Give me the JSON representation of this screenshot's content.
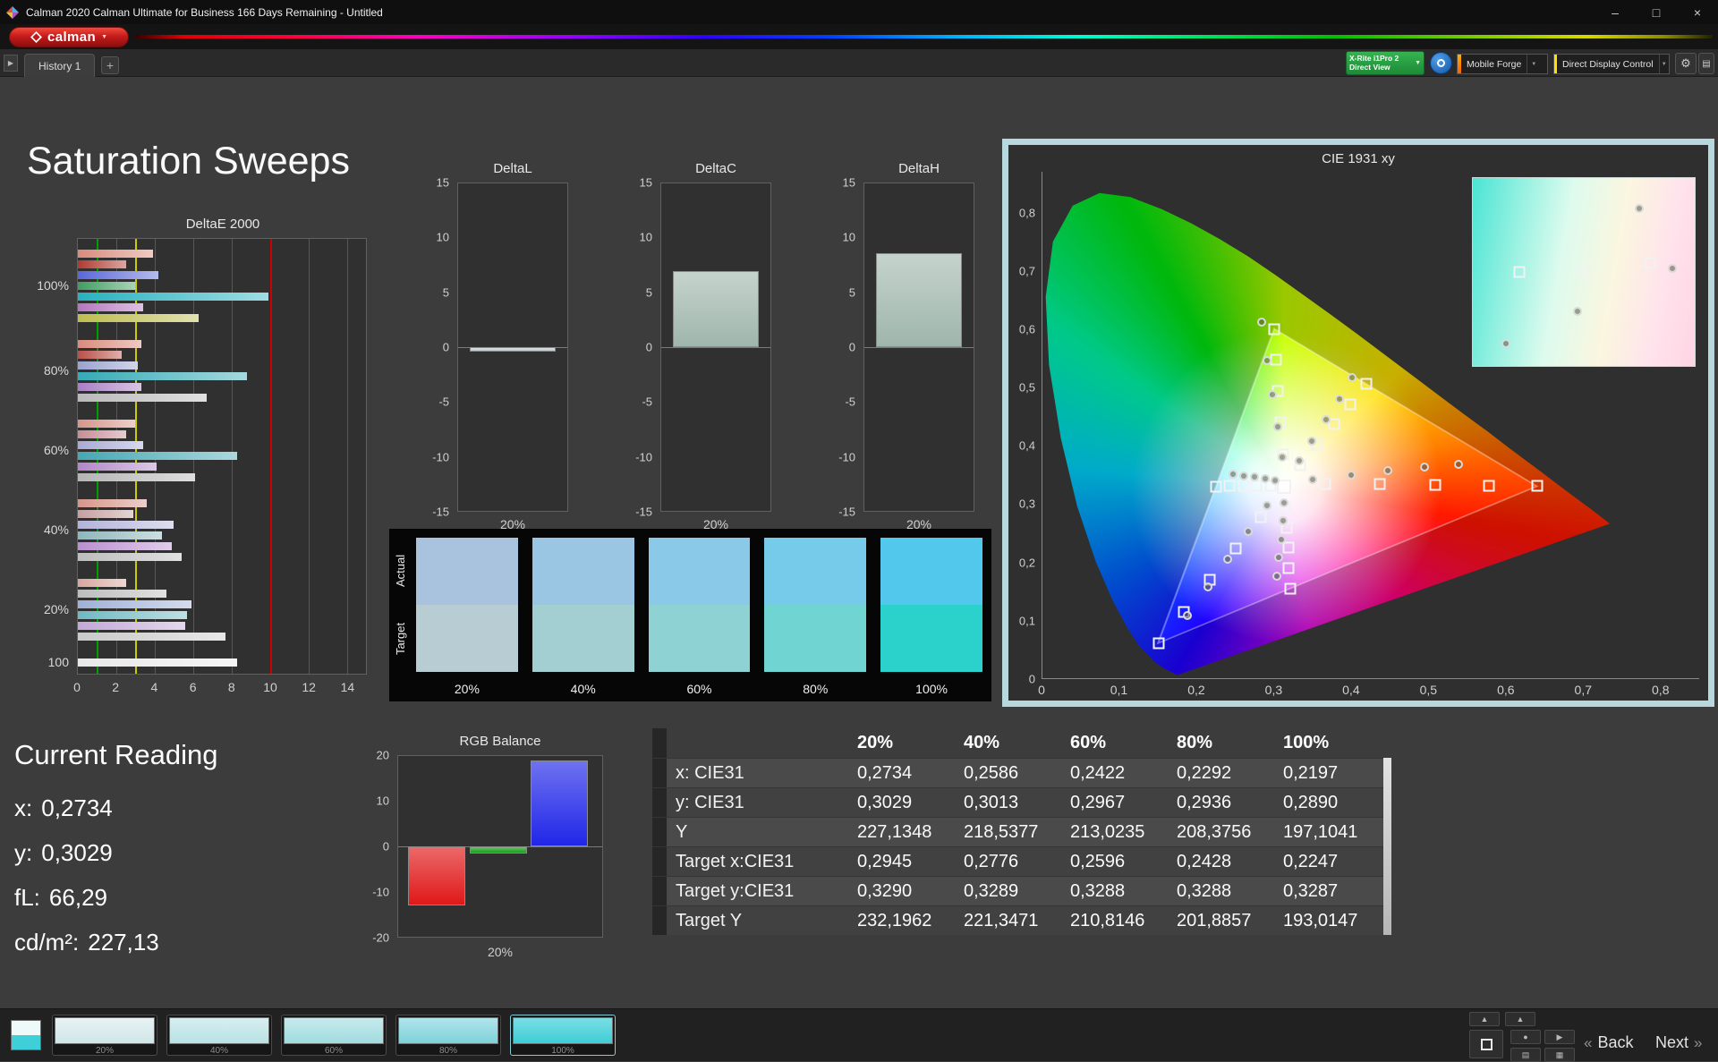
{
  "window": {
    "title": "Calman 2020 Calman Ultimate for Business 166 Days Remaining - Untitled",
    "minimize": "–",
    "maximize": "□",
    "close": "×"
  },
  "toolbar": {
    "logo": "calman",
    "caret": "▼"
  },
  "tab_bar": {
    "panel_toggle": "▶",
    "tab": "History 1",
    "add_tab": "+",
    "meter_button": {
      "line1": "X-Rite i1Pro 2",
      "line2": "Direct View",
      "caret": "▼"
    },
    "source_dropdown": {
      "label": "Mobile Forge",
      "caret": "▼"
    },
    "control_dropdown": {
      "label": "Direct Display Control",
      "caret": "▼"
    },
    "gear": "⚙",
    "layout": "▤"
  },
  "page_title": "Saturation Sweeps",
  "current_reading": {
    "title": "Current Reading",
    "lines": [
      {
        "label": "x:",
        "value": "0,2734"
      },
      {
        "label": "y:",
        "value": "0,3029"
      },
      {
        "label": "fL:",
        "value": "66,29"
      },
      {
        "label": "cd/m²:",
        "value": "227,13"
      }
    ]
  },
  "table": {
    "columns": [
      "20%",
      "40%",
      "60%",
      "80%",
      "100%"
    ],
    "rows": [
      {
        "label": "x: CIE31",
        "values": [
          "0,2734",
          "0,2586",
          "0,2422",
          "0,2292",
          "0,2197"
        ]
      },
      {
        "label": "y: CIE31",
        "values": [
          "0,3029",
          "0,3013",
          "0,2967",
          "0,2936",
          "0,2890"
        ]
      },
      {
        "label": "Y",
        "values": [
          "227,1348",
          "218,5377",
          "213,0235",
          "208,3756",
          "197,1041"
        ]
      },
      {
        "label": "Target x:CIE31",
        "values": [
          "0,2945",
          "0,2776",
          "0,2596",
          "0,2428",
          "0,2247"
        ]
      },
      {
        "label": "Target y:CIE31",
        "values": [
          "0,3290",
          "0,3289",
          "0,3288",
          "0,3288",
          "0,3287"
        ]
      },
      {
        "label": "Target Y",
        "values": [
          "232,1962",
          "221,3471",
          "210,8146",
          "201,8857",
          "193,0147"
        ]
      }
    ]
  },
  "swatches": {
    "row_labels": [
      "Actual",
      "Target"
    ],
    "columns": [
      {
        "label": "20%",
        "actual": "#a9c3df",
        "target": "#b7cdd3"
      },
      {
        "label": "40%",
        "actual": "#9bc6e3",
        "target": "#a3cfd3"
      },
      {
        "label": "60%",
        "actual": "#8ac9e7",
        "target": "#8ed2d3"
      },
      {
        "label": "80%",
        "actual": "#76cbea",
        "target": "#70d4d2"
      },
      {
        "label": "100%",
        "actual": "#52c8ec",
        "target": "#2bd2cb"
      }
    ]
  },
  "chart_data": {
    "deltaE2000": {
      "type": "bar",
      "orientation": "horizontal",
      "title": "DeltaE 2000",
      "xlim": [
        0,
        15
      ],
      "xticks": [
        0,
        2,
        4,
        6,
        8,
        10,
        12,
        14
      ],
      "guides": [
        {
          "value": 1,
          "color": "#00a000"
        },
        {
          "value": 3,
          "color": "#cccc00"
        },
        {
          "value": 10,
          "color": "#cc0000"
        }
      ],
      "groups": [
        {
          "label": "100%",
          "bars": [
            {
              "color": "#d98b7c",
              "value": 3.9
            },
            {
              "color": "#b03a30",
              "value": 2.5
            },
            {
              "color": "#5b68d8",
              "value": 4.2
            },
            {
              "color": "#3f9e62",
              "value": 3.0
            },
            {
              "color": "#27b2c0",
              "value": 9.9
            },
            {
              "color": "#b575c0",
              "value": 3.4
            },
            {
              "color": "#bdbd4e",
              "value": 6.3
            }
          ]
        },
        {
          "label": "80%",
          "bars": [
            {
              "color": "#d98b7c",
              "value": 3.3
            },
            {
              "color": "#b95048",
              "value": 2.3
            },
            {
              "color": "#9aa3cf",
              "value": 3.1
            },
            {
              "color": "#35aab6",
              "value": 8.8
            },
            {
              "color": "#a87fc4",
              "value": 3.3
            },
            {
              "color": "#b9b9b9",
              "value": 6.7
            }
          ]
        },
        {
          "label": "60%",
          "bars": [
            {
              "color": "#d6958a",
              "value": 3.0
            },
            {
              "color": "#c88c96",
              "value": 2.5
            },
            {
              "color": "#a9a9d6",
              "value": 3.4
            },
            {
              "color": "#45a8b4",
              "value": 8.3
            },
            {
              "color": "#b287c8",
              "value": 4.1
            },
            {
              "color": "#b5b5b5",
              "value": 6.1
            }
          ]
        },
        {
          "label": "40%",
          "bars": [
            {
              "color": "#d6958a",
              "value": 3.6
            },
            {
              "color": "#c4a0a0",
              "value": 2.9
            },
            {
              "color": "#b3b3da",
              "value": 5.0
            },
            {
              "color": "#8fb6bc",
              "value": 4.4
            },
            {
              "color": "#bb8fd0",
              "value": 4.9
            },
            {
              "color": "#bdbdbd",
              "value": 5.4
            }
          ]
        },
        {
          "label": "20%",
          "bars": [
            {
              "color": "#d8a79e",
              "value": 2.5
            },
            {
              "color": "#bdbdbd",
              "value": 4.6
            },
            {
              "color": "#9fb0d8",
              "value": 5.9
            },
            {
              "color": "#6fb9c2",
              "value": 5.7
            },
            {
              "color": "#c3a8d8",
              "value": 5.6
            },
            {
              "color": "#c9c9c9",
              "value": 7.7
            }
          ]
        },
        {
          "label": "100",
          "bars": [
            {
              "color": "#e8e8e8",
              "value": 8.3
            }
          ]
        }
      ]
    },
    "deltaL": {
      "type": "bar",
      "title": "DeltaL",
      "ylim": [
        -15,
        15
      ],
      "yticks": [
        15,
        10,
        5,
        0,
        -5,
        -10,
        -15
      ],
      "xtick": "20%",
      "value": -0.4,
      "bar_color": "#b9cfd2"
    },
    "deltaC": {
      "type": "bar",
      "title": "DeltaC",
      "ylim": [
        -15,
        15
      ],
      "yticks": [
        15,
        10,
        5,
        0,
        -5,
        -10,
        -15
      ],
      "xtick": "20%",
      "value": 7.0,
      "bar_color": "#9fb6ac"
    },
    "deltaH": {
      "type": "bar",
      "title": "DeltaH",
      "ylim": [
        -15,
        15
      ],
      "yticks": [
        15,
        10,
        5,
        0,
        -5,
        -10,
        -15
      ],
      "xtick": "20%",
      "value": 8.6,
      "bar_color": "#9fb6ac"
    },
    "rgb_balance": {
      "type": "bar",
      "title": "RGB Balance",
      "ylim": [
        -20,
        20
      ],
      "yticks": [
        20,
        10,
        0,
        -10,
        -20
      ],
      "xtick": "20%",
      "series": [
        {
          "name": "red",
          "value": -13,
          "color": "#e01818"
        },
        {
          "name": "green",
          "value": -1.5,
          "color": "#18a018"
        },
        {
          "name": "blue",
          "value": 19,
          "color": "#2026e8"
        }
      ]
    },
    "cie": {
      "type": "scatter",
      "title": "CIE 1931 xy",
      "xlim": [
        0,
        0.85
      ],
      "ylim": [
        0,
        0.87
      ],
      "tick_values": [
        0,
        0.1,
        0.2,
        0.3,
        0.4,
        0.5,
        0.6,
        0.7,
        0.8
      ],
      "xticks": [
        "0",
        "0,1",
        "0,2",
        "0,3",
        "0,4",
        "0,5",
        "0,6",
        "0,7",
        "0,8"
      ],
      "yticks": [
        "0",
        "0,1",
        "0,2",
        "0,3",
        "0,4",
        "0,5",
        "0,6",
        "0,7",
        "0,8"
      ],
      "white_point": [
        0.3127,
        0.329
      ],
      "triangle": [
        [
          0.64,
          0.33
        ],
        [
          0.3,
          0.6
        ],
        [
          0.15,
          0.06
        ]
      ],
      "locus": [
        [
          0.1741,
          0.005
        ],
        [
          0.1566,
          0.0177
        ],
        [
          0.144,
          0.0297
        ],
        [
          0.1241,
          0.0578
        ],
        [
          0.1096,
          0.0868
        ],
        [
          0.0913,
          0.1327
        ],
        [
          0.0687,
          0.2007
        ],
        [
          0.0454,
          0.295
        ],
        [
          0.0235,
          0.4127
        ],
        [
          0.0082,
          0.5384
        ],
        [
          0.0039,
          0.6548
        ],
        [
          0.0139,
          0.7502
        ],
        [
          0.0389,
          0.812
        ],
        [
          0.0743,
          0.8338
        ],
        [
          0.1142,
          0.8262
        ],
        [
          0.1547,
          0.8059
        ],
        [
          0.1929,
          0.7816
        ],
        [
          0.2296,
          0.7543
        ],
        [
          0.2658,
          0.7243
        ],
        [
          0.3016,
          0.6923
        ],
        [
          0.3373,
          0.6589
        ],
        [
          0.3731,
          0.6245
        ],
        [
          0.4087,
          0.5896
        ],
        [
          0.4441,
          0.5547
        ],
        [
          0.4788,
          0.5202
        ],
        [
          0.5125,
          0.4866
        ],
        [
          0.5448,
          0.4544
        ],
        [
          0.5752,
          0.4242
        ],
        [
          0.6029,
          0.3965
        ],
        [
          0.627,
          0.3725
        ],
        [
          0.6482,
          0.3514
        ],
        [
          0.6658,
          0.334
        ],
        [
          0.6915,
          0.3083
        ],
        [
          0.7079,
          0.292
        ],
        [
          0.719,
          0.2809
        ],
        [
          0.73,
          0.27
        ],
        [
          0.7347,
          0.2653
        ]
      ],
      "targets": [
        [
          0.366,
          0.333
        ],
        [
          0.437,
          0.333
        ],
        [
          0.508,
          0.332
        ],
        [
          0.578,
          0.331
        ],
        [
          0.64,
          0.33
        ],
        [
          0.311,
          0.385
        ],
        [
          0.308,
          0.439
        ],
        [
          0.305,
          0.493
        ],
        [
          0.302,
          0.547
        ],
        [
          0.3,
          0.6
        ],
        [
          0.283,
          0.277
        ],
        [
          0.25,
          0.223
        ],
        [
          0.216,
          0.169
        ],
        [
          0.183,
          0.114
        ],
        [
          0.15,
          0.06
        ],
        [
          0.295,
          0.33
        ],
        [
          0.277,
          0.33
        ],
        [
          0.26,
          0.33
        ],
        [
          0.242,
          0.33
        ],
        [
          0.225,
          0.329
        ],
        [
          0.314,
          0.294
        ],
        [
          0.316,
          0.259
        ],
        [
          0.318,
          0.224
        ],
        [
          0.319,
          0.189
        ],
        [
          0.321,
          0.154
        ],
        [
          0.334,
          0.366
        ],
        [
          0.356,
          0.401
        ],
        [
          0.377,
          0.436
        ],
        [
          0.398,
          0.471
        ],
        [
          0.419,
          0.505
        ]
      ],
      "measured": [
        [
          0.35,
          0.341
        ],
        [
          0.399,
          0.349
        ],
        [
          0.447,
          0.356
        ],
        [
          0.494,
          0.362
        ],
        [
          0.538,
          0.368
        ],
        [
          0.31,
          0.38
        ],
        [
          0.304,
          0.432
        ],
        [
          0.298,
          0.487
        ],
        [
          0.291,
          0.545
        ],
        [
          0.284,
          0.612
        ],
        [
          0.291,
          0.296
        ],
        [
          0.266,
          0.252
        ],
        [
          0.24,
          0.205
        ],
        [
          0.214,
          0.157
        ],
        [
          0.188,
          0.108
        ],
        [
          0.301,
          0.34
        ],
        [
          0.288,
          0.343
        ],
        [
          0.275,
          0.346
        ],
        [
          0.261,
          0.348
        ],
        [
          0.247,
          0.35
        ],
        [
          0.313,
          0.301
        ],
        [
          0.311,
          0.27
        ],
        [
          0.309,
          0.239
        ],
        [
          0.306,
          0.207
        ],
        [
          0.303,
          0.175
        ],
        [
          0.332,
          0.373
        ],
        [
          0.349,
          0.408
        ],
        [
          0.367,
          0.444
        ],
        [
          0.384,
          0.48
        ],
        [
          0.401,
          0.516
        ]
      ],
      "inset": {
        "squares": [
          [
            21,
            50
          ],
          [
            50,
            49
          ],
          [
            80,
            45
          ]
        ],
        "circles": [
          [
            75,
            16
          ],
          [
            47,
            71
          ],
          [
            15,
            88
          ],
          [
            90,
            48
          ]
        ]
      }
    }
  },
  "bottom_bar": {
    "thumbs": [
      {
        "label": "20%",
        "top": "#e8f2f4",
        "bottom": "#cfe6e8",
        "selected": false
      },
      {
        "label": "40%",
        "top": "#d8eef0",
        "bottom": "#b8e2e4",
        "selected": false
      },
      {
        "label": "60%",
        "top": "#c8eaec",
        "bottom": "#a0dce0",
        "selected": false
      },
      {
        "label": "80%",
        "top": "#b0e4ea",
        "bottom": "#7ed2da",
        "selected": false
      },
      {
        "label": "100%",
        "top": "#7adee4",
        "bottom": "#3ecdd6",
        "selected": true
      }
    ],
    "transport": {
      "collapse_buttons": [
        "▲",
        "▲"
      ],
      "icon_buttons": [
        {
          "name": "record-button",
          "glyph": "●"
        },
        {
          "name": "play-button",
          "glyph": "▶"
        },
        {
          "name": "layout-button",
          "glyph": "▤"
        },
        {
          "name": "grid-button",
          "glyph": "▦"
        }
      ],
      "back_chevron": "«",
      "back_label": "Back",
      "next_label": "Next",
      "next_chevron": "»"
    }
  }
}
